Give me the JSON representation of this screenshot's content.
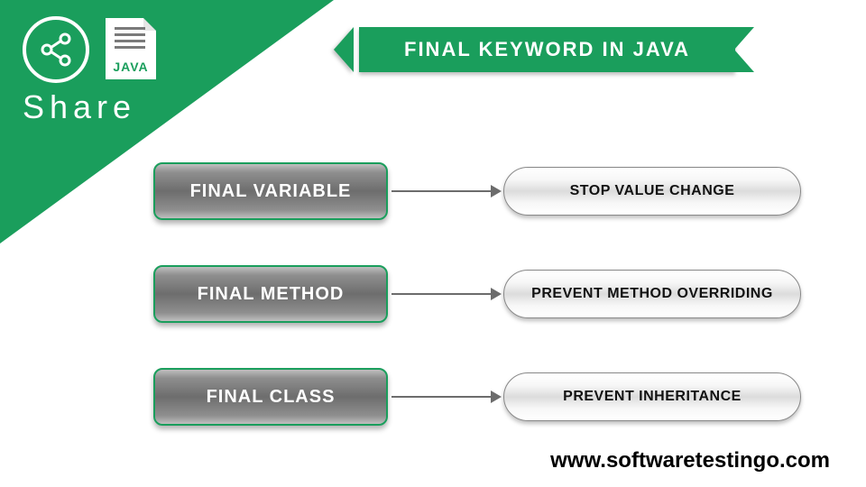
{
  "share": {
    "label": "Share",
    "doc_label": "JAVA"
  },
  "banner": {
    "title": "FINAL KEYWORD IN JAVA"
  },
  "rows": [
    {
      "left": "FINAL VARIABLE",
      "right": "STOP VALUE CHANGE"
    },
    {
      "left": "FINAL METHOD",
      "right": "PREVENT METHOD OVERRIDING"
    },
    {
      "left": "FINAL CLASS",
      "right": "PREVENT INHERITANCE"
    }
  ],
  "footer": {
    "url": "www.softwaretestingo.com"
  },
  "colors": {
    "brand": "#1a9e5c"
  }
}
